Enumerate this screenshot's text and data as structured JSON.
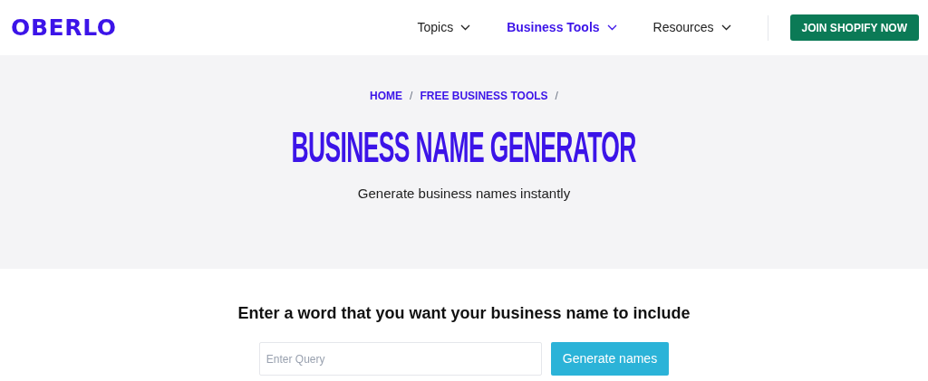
{
  "header": {
    "logo": "OBERLO",
    "nav": [
      {
        "label": "Topics",
        "selected": false
      },
      {
        "label": "Business Tools",
        "selected": true
      },
      {
        "label": "Resources",
        "selected": false
      }
    ],
    "cta": "JOIN SHOPIFY NOW"
  },
  "hero": {
    "breadcrumbs": [
      {
        "label": "HOME",
        "separator": "/"
      },
      {
        "label": "FREE BUSINESS TOOLS",
        "separator": "/"
      }
    ],
    "title": "BUSINESS NAME GENERATOR",
    "subtitle": "Generate business names instantly"
  },
  "form": {
    "heading": "Enter a word that you want your business name to include",
    "query": {
      "placeholder": "Enter Query"
    },
    "button": "Generate names"
  }
}
